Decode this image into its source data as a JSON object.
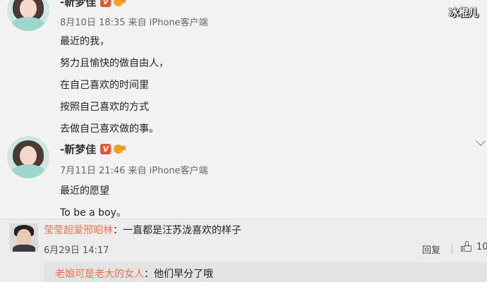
{
  "watermark": "冰棍儿",
  "posts": [
    {
      "author": "-靳梦佳",
      "level": "6",
      "meta": "8月10日 18:35 来自 iPhone客户端",
      "lines": [
        "最近的我，",
        "努力且愉快的做自由人，",
        "在自己喜欢的时间里",
        "按照自己喜欢的方式",
        "去做自己喜欢做的事。"
      ]
    },
    {
      "author": "-靳梦佳",
      "level": "6",
      "meta": "7月11日 21:46 来自 iPhone客户端",
      "lines": [
        "最近的愿望",
        "To be a boy。"
      ]
    }
  ],
  "comment": {
    "user": "莹莹超爱邢昭林",
    "text": "：一直都是汪苏泷喜欢的样子",
    "time": "6月29日 14:17",
    "reply_label": "回复",
    "like_count": "10",
    "nested": {
      "user": "老娘可是老大的女人",
      "text": "：他们早分了哦"
    }
  },
  "colors": {
    "username": "#eb7350",
    "verified_badge": "#e8542c",
    "level_badge": "#f3a316"
  }
}
